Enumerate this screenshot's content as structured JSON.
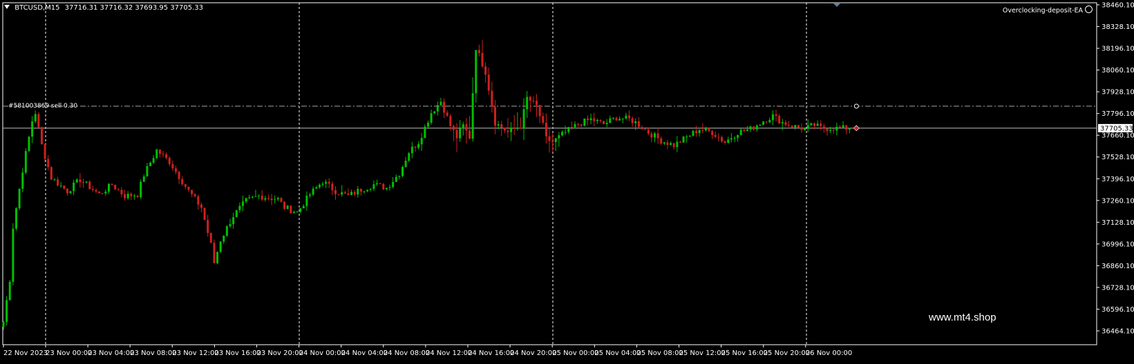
{
  "header": {
    "symbol": "BTCUSD,M15",
    "ohlc": "37716.31 37716.32 37693.95 37705.33"
  },
  "ea_label": "Overclocking-deposit-EA",
  "watermark": "www.mt4.shop",
  "order_label": "#581003869 sell 0.30",
  "current_price_label": "37705.33",
  "colors": {
    "background": "#000000",
    "bull": "#00c000",
    "bear": "#d0201c",
    "grid": "#ffffff",
    "price_line": "#c0c0c0",
    "order_line": "#a8a8a8"
  },
  "chart_data": {
    "type": "candlestick",
    "y_ticks": [
      "38460.10",
      "38328.10",
      "38196.10",
      "38060.10",
      "37928.10",
      "37796.10",
      "37660.10",
      "37528.10",
      "37396.10",
      "37260.10",
      "37128.10",
      "36996.10",
      "36860.10",
      "36728.10",
      "36596.10",
      "36464.10"
    ],
    "x_ticks": [
      "22 Nov 2023",
      "23 Nov 00:00",
      "23 Nov 04:00",
      "23 Nov 08:00",
      "23 Nov 12:00",
      "23 Nov 16:00",
      "23 Nov 20:00",
      "24 Nov 00:00",
      "24 Nov 04:00",
      "24 Nov 08:00",
      "24 Nov 12:00",
      "24 Nov 16:00",
      "24 Nov 20:00",
      "25 Nov 00:00",
      "25 Nov 04:00",
      "25 Nov 08:00",
      "25 Nov 12:00",
      "25 Nov 16:00",
      "25 Nov 20:00",
      "26 Nov 00:00"
    ],
    "ylim": [
      36464.1,
      38460.1
    ],
    "current_price": 37705.33,
    "order_price": 37840.0,
    "day_separators": [
      "23 Nov 00:00",
      "24 Nov 00:00",
      "25 Nov 00:00",
      "26 Nov 00:00"
    ],
    "path": [
      [
        0,
        36520
      ],
      [
        2,
        36780
      ],
      [
        3,
        37100
      ],
      [
        6,
        37450
      ],
      [
        9,
        37750
      ],
      [
        10,
        37800
      ],
      [
        12,
        37600
      ],
      [
        15,
        37400
      ],
      [
        20,
        37320
      ],
      [
        24,
        37390
      ],
      [
        30,
        37300
      ],
      [
        34,
        37360
      ],
      [
        38,
        37290
      ],
      [
        42,
        37300
      ],
      [
        44,
        37420
      ],
      [
        48,
        37570
      ],
      [
        52,
        37500
      ],
      [
        58,
        37320
      ],
      [
        62,
        37220
      ],
      [
        65,
        36990
      ],
      [
        66,
        36880
      ],
      [
        68,
        37020
      ],
      [
        72,
        37170
      ],
      [
        76,
        37260
      ],
      [
        80,
        37290
      ],
      [
        86,
        37270
      ],
      [
        88,
        37220
      ],
      [
        92,
        37190
      ],
      [
        96,
        37300
      ],
      [
        100,
        37380
      ],
      [
        104,
        37320
      ],
      [
        108,
        37290
      ],
      [
        112,
        37330
      ],
      [
        116,
        37360
      ],
      [
        120,
        37340
      ],
      [
        124,
        37430
      ],
      [
        127,
        37560
      ],
      [
        130,
        37620
      ],
      [
        134,
        37800
      ],
      [
        137,
        37870
      ],
      [
        140,
        37720
      ],
      [
        142,
        37650
      ],
      [
        144,
        37720
      ],
      [
        146,
        37650
      ],
      [
        148,
        38200
      ],
      [
        151,
        38050
      ],
      [
        154,
        37740
      ],
      [
        158,
        37680
      ],
      [
        162,
        37720
      ],
      [
        164,
        37890
      ],
      [
        167,
        37840
      ],
      [
        169,
        37720
      ],
      [
        170,
        37640
      ],
      [
        172,
        37620
      ],
      [
        176,
        37680
      ],
      [
        180,
        37730
      ],
      [
        184,
        37760
      ],
      [
        188,
        37730
      ],
      [
        192,
        37770
      ],
      [
        196,
        37760
      ],
      [
        198,
        37740
      ],
      [
        202,
        37680
      ],
      [
        206,
        37630
      ],
      [
        210,
        37600
      ],
      [
        214,
        37650
      ],
      [
        218,
        37700
      ],
      [
        222,
        37680
      ],
      [
        226,
        37620
      ],
      [
        230,
        37680
      ],
      [
        234,
        37700
      ],
      [
        238,
        37750
      ],
      [
        241,
        37780
      ],
      [
        244,
        37740
      ],
      [
        247,
        37720
      ],
      [
        251,
        37700
      ],
      [
        254,
        37725
      ],
      [
        256,
        37705
      ]
    ]
  }
}
